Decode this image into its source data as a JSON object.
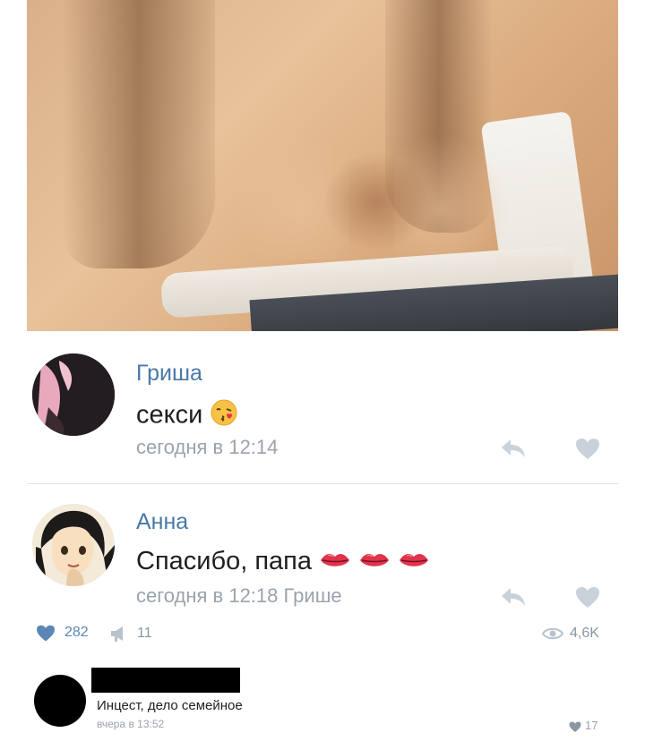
{
  "post": {
    "photo_icon": "photo"
  },
  "comments": [
    {
      "author": "Гриша",
      "text": "секси",
      "emoji": "kissing-face-emoji",
      "meta": "сегодня в 12:14"
    },
    {
      "author": "Анна",
      "text": "Спасибо, папа",
      "emoji": "lips-emoji",
      "meta": "сегодня в 12:18 Грише"
    }
  ],
  "stats": {
    "likes": "282",
    "shares": "11",
    "views": "4,6K"
  },
  "bottom_comment": {
    "text": "Инцест, дело семейное",
    "meta": "вчера в 13:52",
    "likes": "17"
  },
  "colors": {
    "link": "#4a78a8",
    "muted": "#9aa3ad",
    "like_blue": "#5b86b5"
  }
}
